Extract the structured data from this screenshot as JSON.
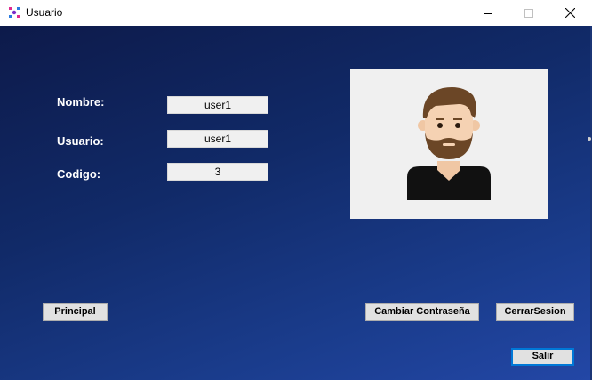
{
  "window": {
    "title": "Usuario",
    "icon": "app-icon",
    "controls": [
      "minimize-icon",
      "maximize-icon",
      "close-icon"
    ]
  },
  "form": {
    "nombre_label": "Nombre:",
    "nombre_value": "user1",
    "usuario_label": "Usuario:",
    "usuario_value": "user1",
    "codigo_label": "Codigo:",
    "codigo_value": "3"
  },
  "buttons": {
    "principal": "Principal",
    "cambiar_contrasena": "Cambiar Contraseña",
    "cerrar_sesion": "CerrarSesion",
    "salir": "Salir"
  },
  "picture": {
    "icon": "user-avatar-icon"
  },
  "colors": {
    "background_top": "#0d1a4a",
    "background_bottom": "#2347a6",
    "default_button_border": "#0078d7"
  }
}
